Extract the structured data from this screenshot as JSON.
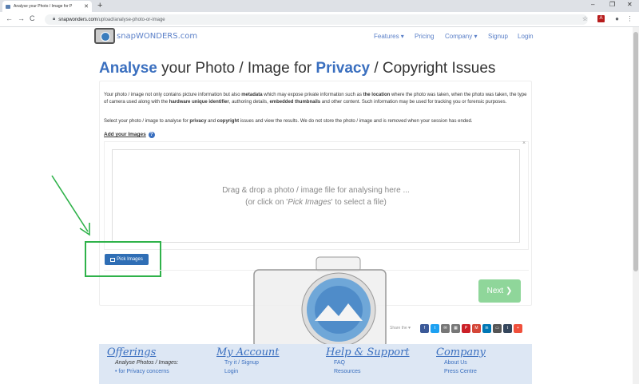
{
  "browser": {
    "tab_title": "Analyse your Photo / Image for P",
    "tab_close": "✕",
    "new_tab": "+",
    "url_host": "snapwonders.com",
    "url_path": "/upload/analyse-photo-or-image",
    "minimize": "–",
    "maximize": "❐",
    "close": "✕"
  },
  "header": {
    "logo_text_a": "snap",
    "logo_text_b": "WONDERS",
    "logo_text_c": ".com",
    "nav": [
      "Features ▾",
      "Pricing",
      "Company ▾",
      "Signup",
      "Login"
    ]
  },
  "main": {
    "title_a": "Analyse",
    "title_b": " your Photo / Image for ",
    "title_c": "Privacy",
    "title_d": " / Copyright Issues",
    "intro_1": "Your photo / image not only contains picture information but also ",
    "intro_metadata": "metadata",
    "intro_2": " which may expose private information such as ",
    "intro_location": "the location",
    "intro_3": " where the photo was taken, when the photo was taken, the type of camera used along with the ",
    "intro_hwid": "hardware unique identifier",
    "intro_4": ", authoring details, ",
    "intro_thumbs": "embedded thumbnails",
    "intro_5": " and other content. Such information may be used for tracking you or forensic purposes.",
    "select_1": "Select your photo / image to analyse for ",
    "select_privacy": "privacy",
    "select_2": " and ",
    "select_copyright": "copyright",
    "select_3": " issues and view the results. We do not store the photo / image and is removed when your session has ended.",
    "add_label": "Add your Images",
    "help": "?",
    "drop_close": "×",
    "drop_line1": "Drag & drop a photo / image file for analysing here ...",
    "drop_line2a": "(or click on '",
    "drop_line2b": "Pick Images",
    "drop_line2c": "' to select a file)",
    "pick_label": "Pick Images",
    "next_label": "Next ❯"
  },
  "share": {
    "label": "Share the ♥",
    "buttons": [
      {
        "glyph": "f",
        "color": "#3b5998"
      },
      {
        "glyph": "t",
        "color": "#1da1f2"
      },
      {
        "glyph": "✉",
        "color": "#777777"
      },
      {
        "glyph": "▦",
        "color": "#777777"
      },
      {
        "glyph": "P",
        "color": "#cb2027"
      },
      {
        "glyph": "M",
        "color": "#d44638"
      },
      {
        "glyph": "in",
        "color": "#0077b5"
      },
      {
        "glyph": "▭",
        "color": "#555555"
      },
      {
        "glyph": "t",
        "color": "#35465c"
      },
      {
        "glyph": "+",
        "color": "#f0503c"
      }
    ]
  },
  "footer": {
    "offerings_head": "Offerings",
    "offerings_1": "Analyse Photos / Images:",
    "offerings_2": "• for Privacy concerns",
    "account_head": "My Account",
    "account_1": "Try it / Signup",
    "account_2": "Login",
    "help_head": "Help & Support",
    "help_1": "FAQ",
    "help_2": "Resources",
    "company_head": "Company",
    "company_1": "About Us",
    "company_2": "Press Centre"
  }
}
